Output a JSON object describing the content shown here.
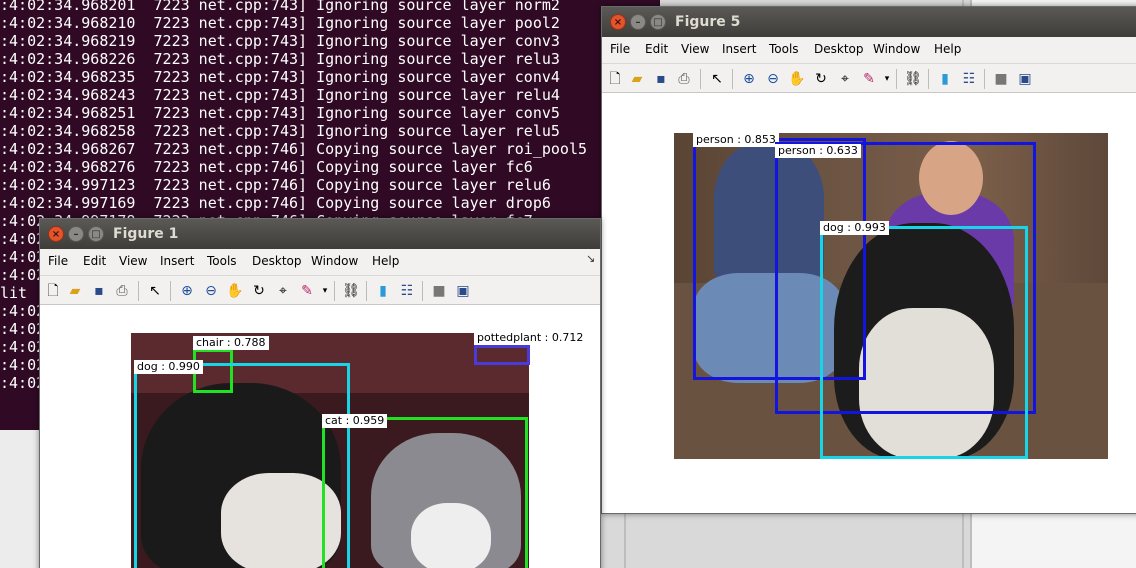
{
  "terminal": {
    "lines": [
      ":4:02:34.968201  7223 net.cpp:743] Ignoring source layer norm2",
      ":4:02:34.968210  7223 net.cpp:743] Ignoring source layer pool2",
      ":4:02:34.968219  7223 net.cpp:743] Ignoring source layer conv3",
      ":4:02:34.968226  7223 net.cpp:743] Ignoring source layer relu3",
      ":4:02:34.968235  7223 net.cpp:743] Ignoring source layer conv4",
      ":4:02:34.968243  7223 net.cpp:743] Ignoring source layer relu4",
      ":4:02:34.968251  7223 net.cpp:743] Ignoring source layer conv5",
      ":4:02:34.968258  7223 net.cpp:743] Ignoring source layer relu5",
      ":4:02:34.968267  7223 net.cpp:746] Copying source layer roi_pool5",
      ":4:02:34.968276  7223 net.cpp:746] Copying source layer fc6",
      ":4:02:34.997123  7223 net.cpp:746] Copying source layer relu6",
      ":4:02:34.997169  7223 net.cpp:746] Copying source layer drop6",
      ":4:02:34.997178  7223 net.cpp:746] Copying source layer fc7",
      ":4:02",
      ":4:02",
      ":4:02",
      "lit",
      ":4:02",
      ":4:02",
      ":4:02",
      ":4:02",
      ":4:02"
    ]
  },
  "figure5": {
    "title": "Figure 5",
    "menu": [
      "File",
      "Edit",
      "View",
      "Insert",
      "Tools",
      "Desktop",
      "Window",
      "Help"
    ],
    "detections": [
      {
        "label": "person : 0.853",
        "color": "#1414e0"
      },
      {
        "label": "person : 0.633",
        "color": "#1414e0"
      },
      {
        "label": "dog : 0.993",
        "color": "#19d4e6"
      }
    ]
  },
  "figure1": {
    "title": "Figure 1",
    "menu": [
      "File",
      "Edit",
      "View",
      "Insert",
      "Tools",
      "Desktop",
      "Window",
      "Help"
    ],
    "undock_icon": "undock-arrow-icon",
    "detections": [
      {
        "label": "chair : 0.788",
        "color": "#22e022"
      },
      {
        "label": "pottedplant : 0.712",
        "color": "#4a3ad6"
      },
      {
        "label": "dog : 0.990",
        "color": "#19d4e6"
      },
      {
        "label": "cat : 0.959",
        "color": "#22e022"
      }
    ]
  },
  "toolbar_icons": [
    "new-figure-icon",
    "open-file-icon",
    "save-icon",
    "print-icon",
    "pointer-icon",
    "zoom-in-icon",
    "zoom-out-icon",
    "pan-icon",
    "rotate-3d-icon",
    "data-cursor-icon",
    "brush-icon",
    "link-plot-icon",
    "colorbar-icon",
    "legend-icon",
    "hide-plot-tools-icon",
    "show-plot-tools-icon"
  ]
}
